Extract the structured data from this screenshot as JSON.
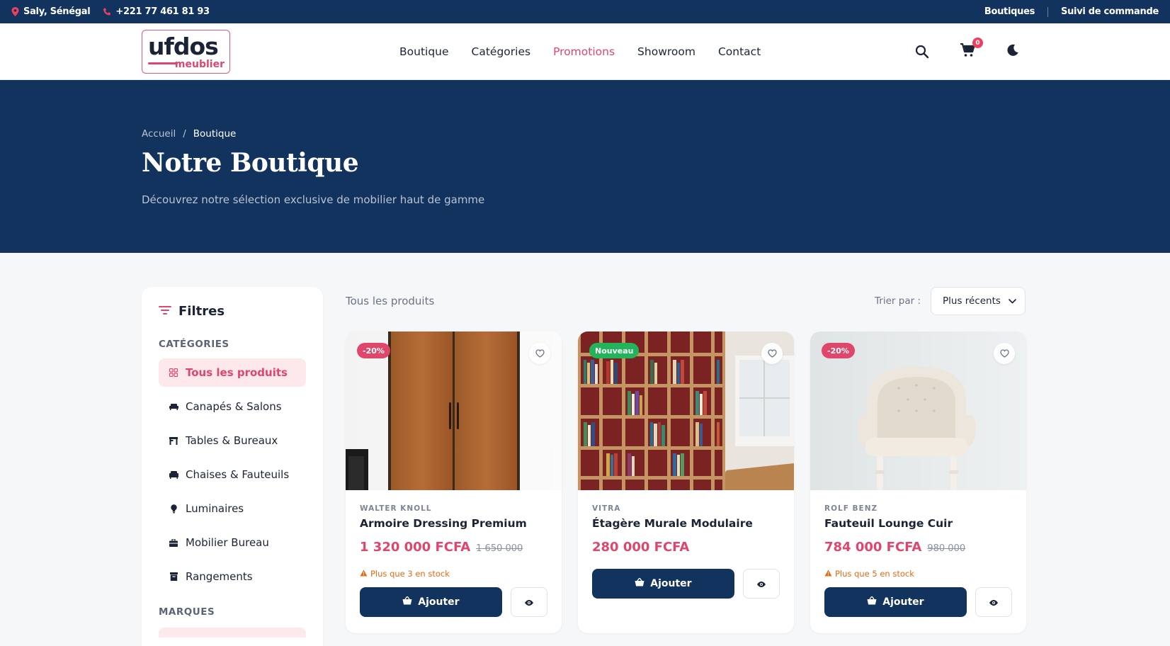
{
  "topbar": {
    "location": "Saly, Sénégal",
    "phone": "+221 77 461 81 93",
    "links": [
      "Boutiques",
      "Suivi de commande"
    ]
  },
  "logo": {
    "word": "ufdos",
    "sub": "meublier"
  },
  "nav": [
    "Boutique",
    "Catégories",
    "Promotions",
    "Showroom",
    "Contact"
  ],
  "nav_active": "Promotions",
  "cart_count": "0",
  "hero": {
    "breadcrumb": [
      "Accueil",
      "/",
      "Boutique"
    ],
    "title": "Notre Boutique",
    "subtitle": "Découvrez notre sélection exclusive de mobilier haut de gamme"
  },
  "sidebar": {
    "title": "Filtres",
    "categories_label": "CATÉGORIES",
    "categories": [
      "Tous les produits",
      "Canapés & Salons",
      "Tables & Bureaux",
      "Chaises & Fauteuils",
      "Luminaires",
      "Mobilier Bureau",
      "Rangements"
    ],
    "brands_label": "MARQUES"
  },
  "toolbar": {
    "count_label": "Tous les produits",
    "sort_label": "Trier par :",
    "sort_value": "Plus récents"
  },
  "products": [
    {
      "badge": "-20%",
      "brand": "WALTER KNOLL",
      "name": "Armoire Dressing Premium",
      "price": "1 320 000 FCFA",
      "old_price": "1 650 000",
      "stock": "Plus que 3 en stock",
      "add_label": "Ajouter"
    },
    {
      "badge": "Nouveau",
      "brand": "VITRA",
      "name": "Étagère Murale Modulaire",
      "price": "280 000 FCFA",
      "add_label": "Ajouter"
    },
    {
      "badge": "-20%",
      "brand": "ROLF BENZ",
      "name": "Fauteuil Lounge Cuir",
      "price": "784 000 FCFA",
      "old_price": "980 000",
      "stock": "Plus que 5 en stock",
      "add_label": "Ajouter"
    }
  ],
  "colors": {
    "navy": "#13335f",
    "accent": "#e0466b",
    "success": "#23b35a",
    "warning": "#e86a13"
  }
}
